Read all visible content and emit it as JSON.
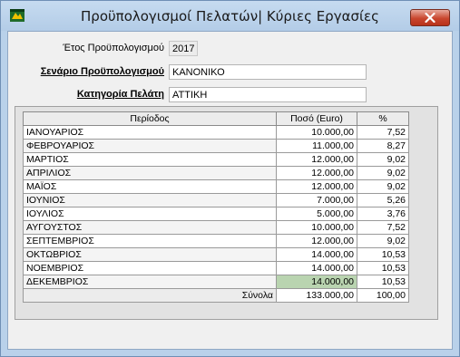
{
  "window": {
    "title": "Προϋπολογισμοί Πελατών| Κύριες Εργασίες",
    "colors": {
      "titlebar": "#b9d1ea",
      "close": "#c9462e",
      "selected_cell": "#b9d4b0"
    }
  },
  "form": {
    "year_label": "Έτος Προϋπολογισμού",
    "year_value": "2017",
    "scenario_label": "Σενάριο Προϋπολογισμού",
    "scenario_value": "ΚΑΝΟΝΙΚΟ",
    "category_label": "Κατηγορία Πελάτη",
    "category_value": "ΑΤΤΙΚΗ"
  },
  "grid": {
    "headers": [
      "Περίοδος",
      "Ποσό (Euro)",
      "%"
    ],
    "rows": [
      {
        "period": "ΙΑΝΟΥΑΡΙΟΣ",
        "amount": "10.000,00",
        "pct": "7,52"
      },
      {
        "period": "ΦΕΒΡΟΥΑΡΙΟΣ",
        "amount": "11.000,00",
        "pct": "8,27"
      },
      {
        "period": "ΜΑΡΤΙΟΣ",
        "amount": "12.000,00",
        "pct": "9,02"
      },
      {
        "period": "ΑΠΡΙΛΙΟΣ",
        "amount": "12.000,00",
        "pct": "9,02"
      },
      {
        "period": "ΜΑΪΟΣ",
        "amount": "12.000,00",
        "pct": "9,02"
      },
      {
        "period": "ΙΟΥΝΙΟΣ",
        "amount": "7.000,00",
        "pct": "5,26"
      },
      {
        "period": "ΙΟΥΛΙΟΣ",
        "amount": "5.000,00",
        "pct": "3,76"
      },
      {
        "period": "ΑΥΓΟΥΣΤΟΣ",
        "amount": "10.000,00",
        "pct": "7,52"
      },
      {
        "period": "ΣΕΠΤΕΜΒΡΙΟΣ",
        "amount": "12.000,00",
        "pct": "9,02"
      },
      {
        "period": "ΟΚΤΩΒΡΙΟΣ",
        "amount": "14.000,00",
        "pct": "10,53"
      },
      {
        "period": "ΝΟΕΜΒΡΙΟΣ",
        "amount": "14.000,00",
        "pct": "10,53"
      },
      {
        "period": "ΔΕΚΕΜΒΡΙΟΣ",
        "amount": "14.000,00",
        "pct": "10,53",
        "selected": true
      }
    ],
    "totals": {
      "label": "Σύνολα",
      "amount": "133.000,00",
      "pct": "100,00"
    }
  }
}
